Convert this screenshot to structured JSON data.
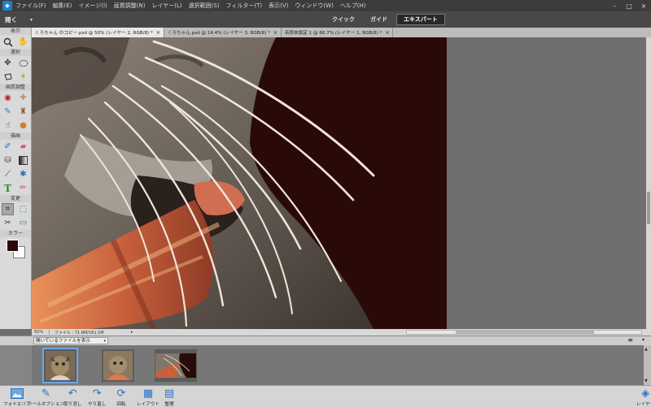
{
  "menubar": {
    "items": [
      "ファイル(F)",
      "編集(E)",
      "イメージ(I)",
      "画質調整(N)",
      "レイヤー(L)",
      "選択範囲(S)",
      "フィルター(T)",
      "表示(V)",
      "ウィンドウ(W)",
      "ヘルプ(H)"
    ],
    "minimize": "–",
    "maximize": "□",
    "close": "×"
  },
  "modebar": {
    "open_label": "開く",
    "dropdown_glyph": "▾",
    "modes": [
      "クイック",
      "ガイド",
      "エキスパート"
    ],
    "active_mode": "エキスパート"
  },
  "toolbox": {
    "sections": [
      "表示",
      "選択",
      "画質調整",
      "描画",
      "変更",
      "カラー"
    ],
    "foreground_color": "#2a0a07",
    "background_color": "#ffffff"
  },
  "tabs": [
    {
      "label": "くろちゃん のコピー.psd @ 50% (レイヤー 2, RGB/8) *",
      "close": "×",
      "active": true
    },
    {
      "label": "くろちゃん.psd @ 14.4% (レイヤー 3, RGB/8) *",
      "close": "×",
      "active": false
    },
    {
      "label": "名称未設定 1 @ 66.7% (レイヤー 1, RGB/8) *",
      "close": "×",
      "active": false
    }
  ],
  "status": {
    "zoom": "50%",
    "file_info": "ファイル : 71.6M/161.1M",
    "arrow": "▸"
  },
  "bin": {
    "select_label": "開いているファイルを表示",
    "select_caret": "▾",
    "menu_glyph": "≡",
    "collapse_glyph": "▾"
  },
  "bottombar": {
    "items": [
      "フォトエリア",
      "ツールオプション",
      "取り消し",
      "やり直し",
      "回転",
      "レイアウト",
      "整理",
      "レイヤー"
    ]
  },
  "colors": {
    "canvas_bg": "#2a0a07",
    "accent": "#2a73c2"
  }
}
